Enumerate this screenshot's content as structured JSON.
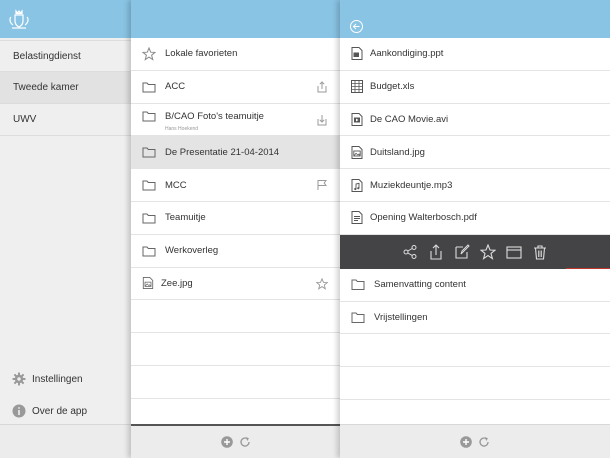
{
  "colors": {
    "header": "#89c4e4",
    "selected": "#e4e4e4",
    "actionbar": "#444446"
  },
  "sidebar": {
    "logo_icon": "coat-of-arms-icon",
    "organisations": [
      "Belastingdienst",
      "Tweede kamer",
      "UWV"
    ],
    "selected": "Tweede kamer",
    "bottom": {
      "settings": "Instellingen",
      "about": "Over de app"
    }
  },
  "folders": {
    "favorites": "Lokale favorieten",
    "items": [
      {
        "name": "ACC",
        "action_icon": "upload-icon"
      },
      {
        "name": "B/CAO Foto's teamuitje",
        "sub": "Hans Hoekend",
        "action_icon": "download-icon"
      },
      {
        "name": "De Presentatie 21-04-2014",
        "selected": true
      },
      {
        "name": "MCC",
        "action_icon": "flag-icon"
      },
      {
        "name": "Teamuitje"
      },
      {
        "name": "Werkoverleg"
      }
    ],
    "file": {
      "name": "Zee.jpg",
      "action_icon": "star-icon"
    }
  },
  "files": {
    "items": [
      {
        "name": "Aankondiging.ppt",
        "icon": "presentation-file-icon"
      },
      {
        "name": "Budget.xls",
        "icon": "spreadsheet-file-icon"
      },
      {
        "name": "De CAO Movie.avi",
        "icon": "video-file-icon"
      },
      {
        "name": "Duitsland.jpg",
        "icon": "image-file-icon"
      },
      {
        "name": "Muziekdeuntje.mp3",
        "icon": "audio-file-icon"
      },
      {
        "name": "Opening Walterbosch.pdf",
        "icon": "document-file-icon"
      }
    ],
    "actions": [
      "share-icon",
      "export-icon",
      "edit-icon",
      "star-icon",
      "window-icon",
      "trash-icon"
    ],
    "subfolders": [
      "Samenvatting content",
      "Vrijstellingen"
    ]
  },
  "footer": {
    "add_icon": "add-icon",
    "refresh_icon": "refresh-icon"
  }
}
